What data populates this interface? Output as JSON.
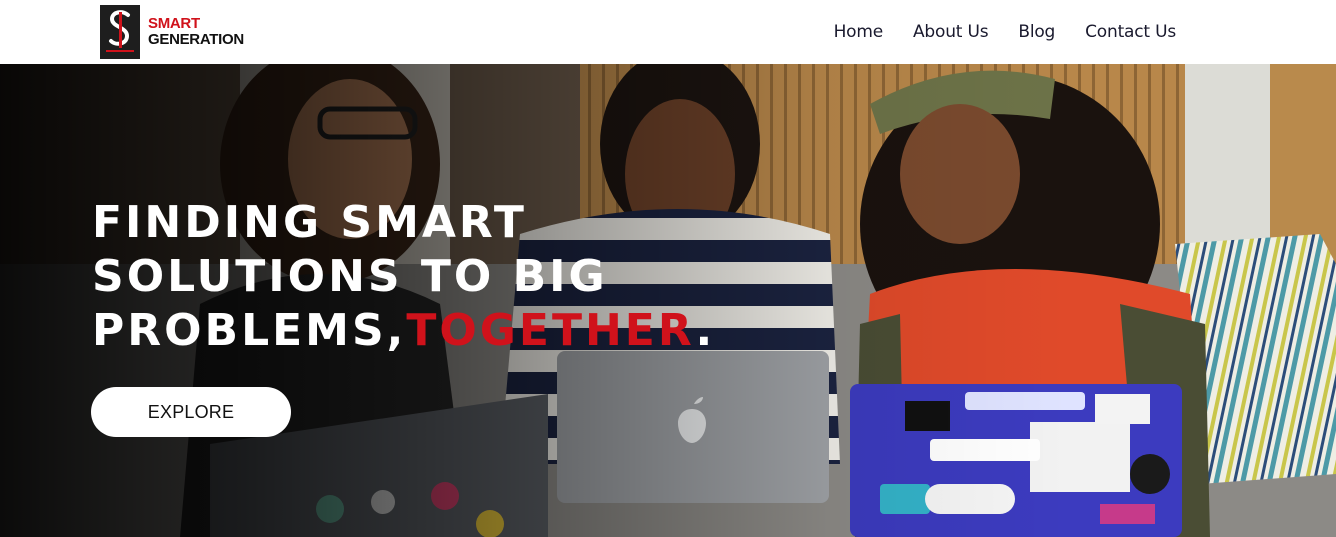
{
  "brand": {
    "line1": "SMART",
    "line2": "GENERATION",
    "accent_color": "#d0121b",
    "logo_icon": "smart-generation-logo-icon"
  },
  "nav": {
    "items": [
      {
        "label": "Home"
      },
      {
        "label": "About Us"
      },
      {
        "label": "Blog"
      },
      {
        "label": "Contact Us"
      }
    ]
  },
  "hero": {
    "headline_line1": "FINDING SMART",
    "headline_line2": "SOLUTIONS TO BIG",
    "headline_line3_prefix": "PROBLEMS,",
    "headline_line3_accent": "TOGETHER",
    "headline_line3_suffix": ".",
    "cta_label": "EXPLORE",
    "image_subject": "three women smiling while working on laptops"
  }
}
